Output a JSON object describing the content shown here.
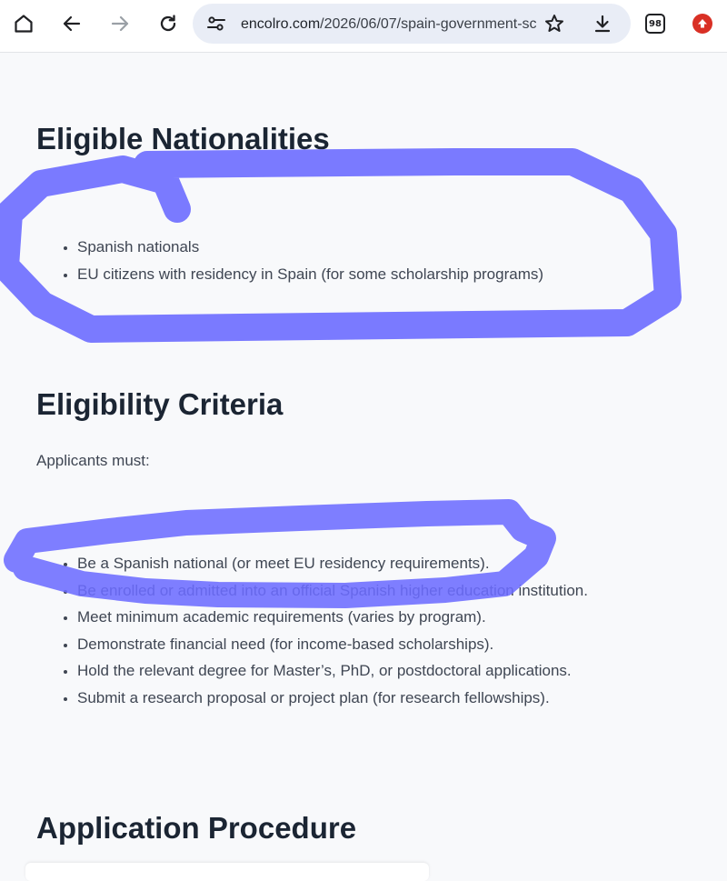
{
  "browser": {
    "url_host": "encolro.com",
    "url_path": "/2026/06/07/spain-government-sc",
    "tab_count": "98",
    "icons": [
      "home-icon",
      "back-icon",
      "forward-icon",
      "reload-icon",
      "site-settings-icon",
      "bookmark-star-icon",
      "download-icon",
      "tab-switcher-icon",
      "update-icon"
    ]
  },
  "sections": {
    "nationalities": {
      "heading": "Eligible Nationalities",
      "items": [
        "Spanish nationals",
        "EU citizens with residency in Spain (for some scholarship programs)"
      ]
    },
    "criteria": {
      "heading": "Eligibility Criteria",
      "intro": "Applicants must:",
      "items": [
        "Be a Spanish national (or meet EU residency requirements).",
        "Be enrolled or admitted into an official Spanish higher education institution.",
        "Meet minimum academic requirements (varies by program).",
        "Demonstrate financial need (for income-based scholarships).",
        "Hold the relevant degree for Master’s, PhD, or postdoctoral applications.",
        "Submit a research proposal or project plan (for research fellowships)."
      ]
    },
    "procedure": {
      "heading": "Application Procedure"
    }
  },
  "colors": {
    "heading": "#1b2533",
    "body_text": "#3f4653",
    "annotation_stroke": "#6c6cff",
    "update_badge": "#d93025",
    "omnibox_bg": "#e9edf6"
  }
}
